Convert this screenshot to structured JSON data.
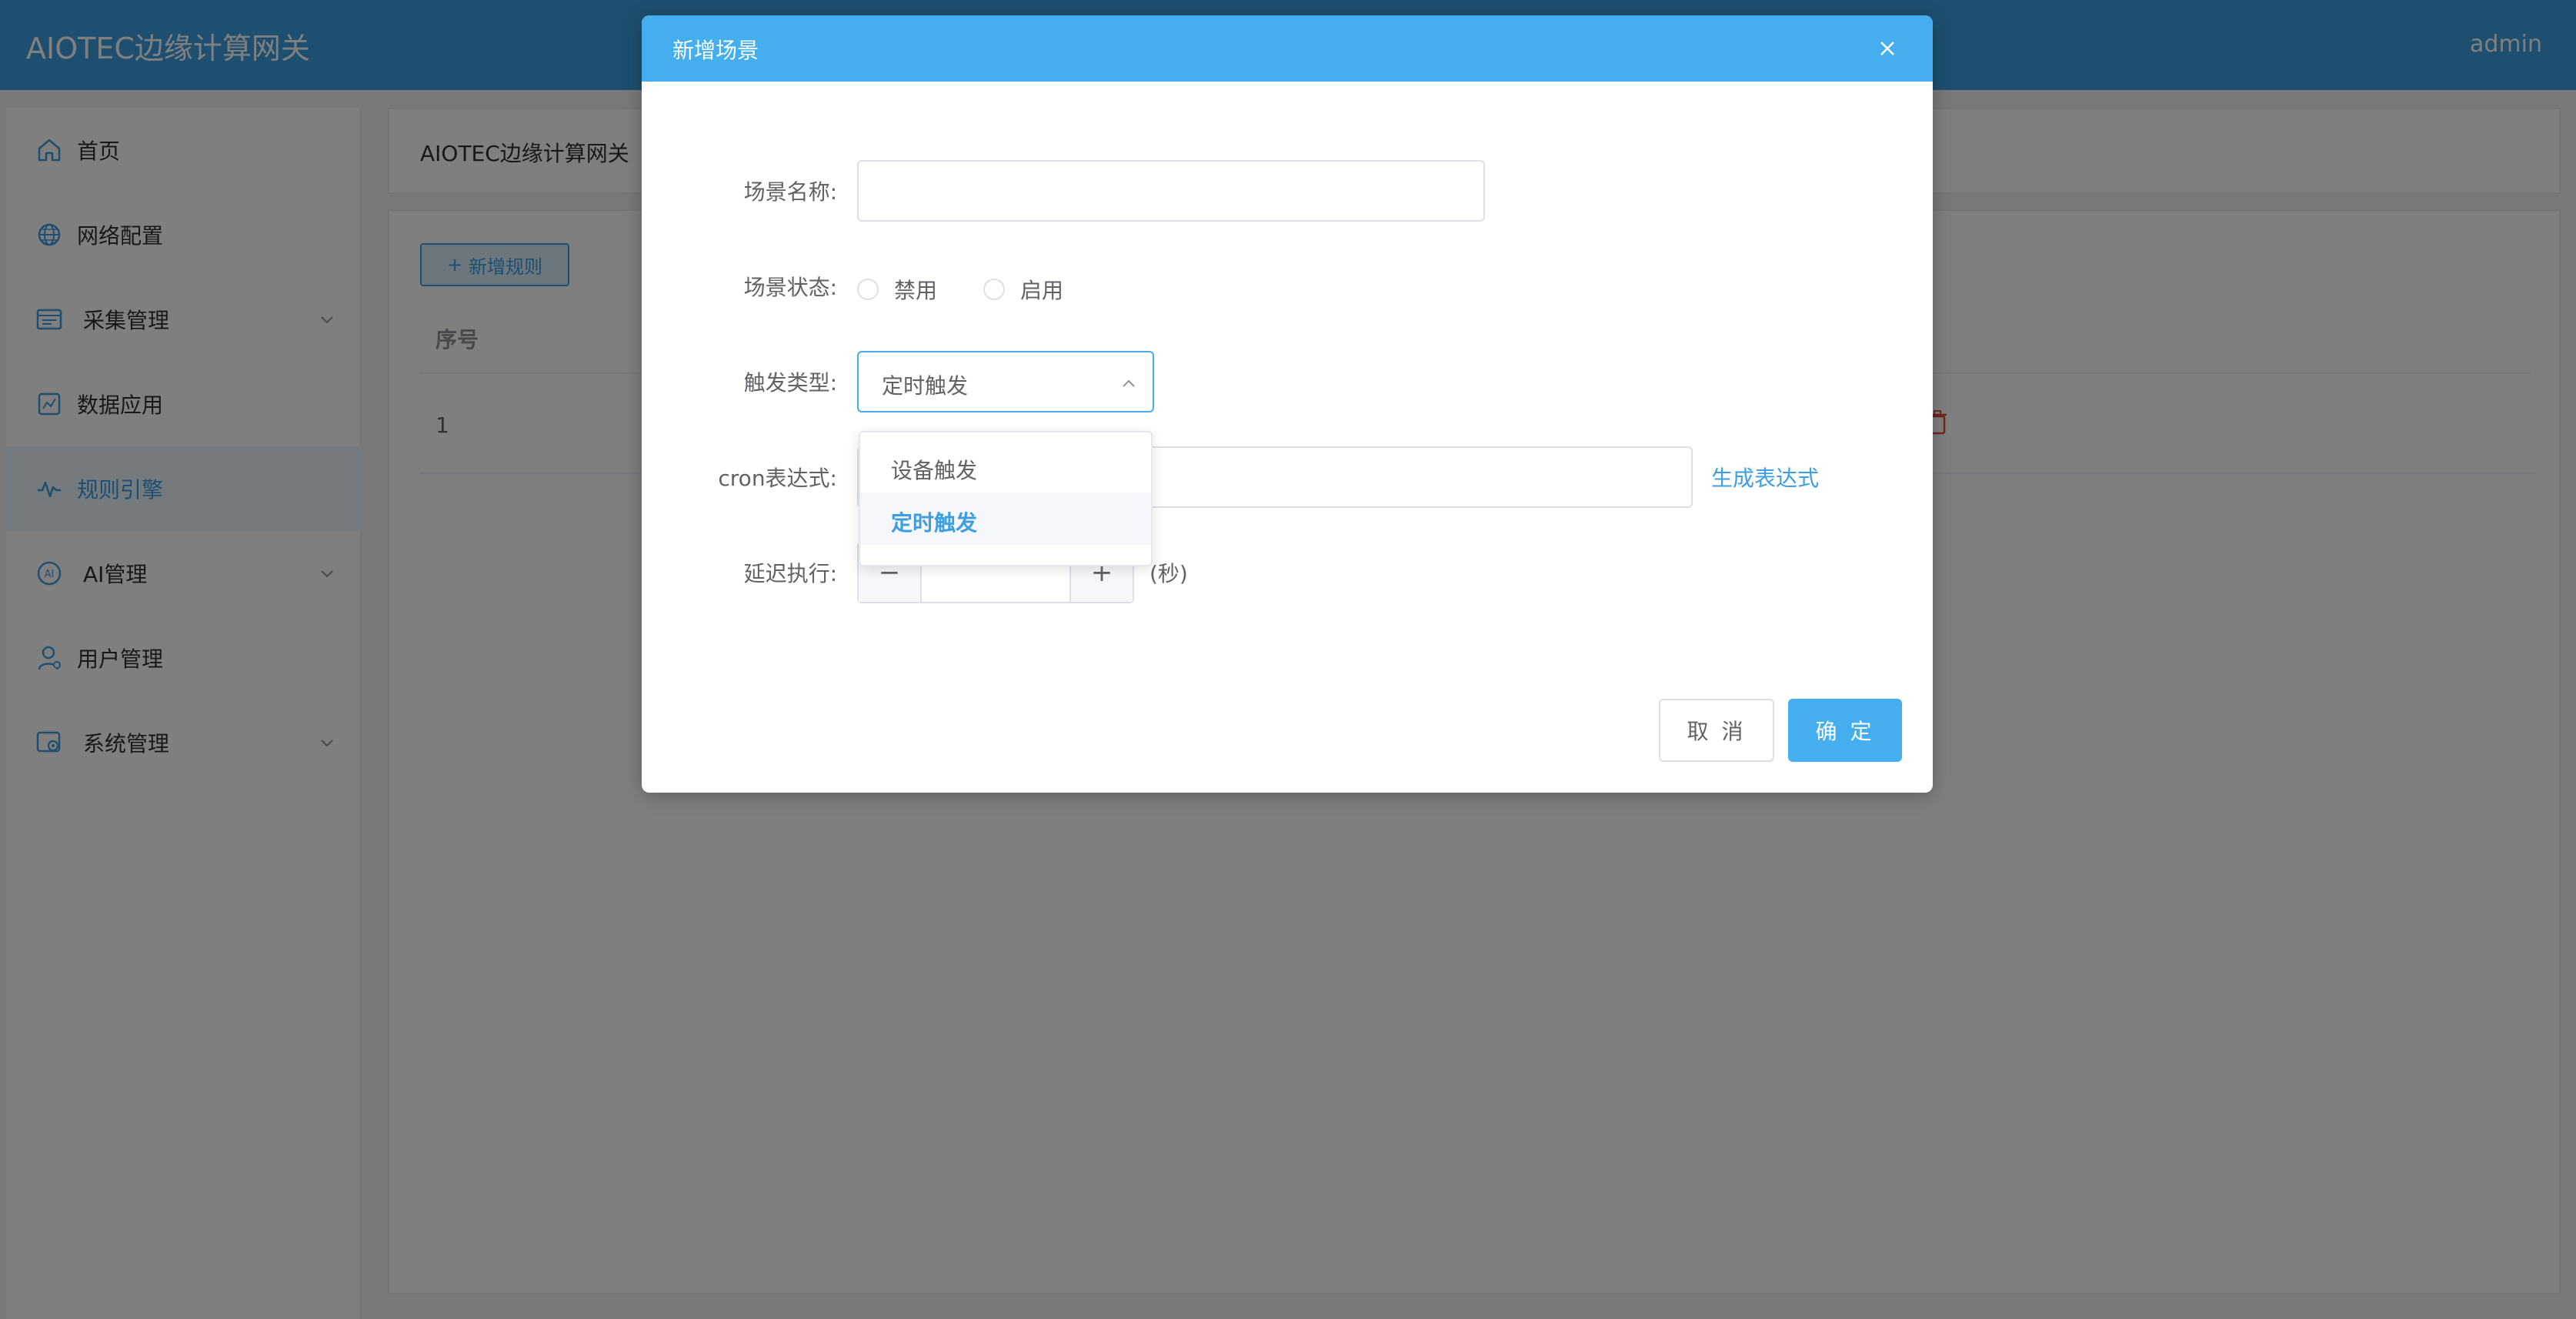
{
  "header": {
    "title": "AIOTEC边缘计算网关",
    "user": "admin"
  },
  "sidebar": {
    "items": [
      {
        "label": "首页",
        "icon": "home-icon"
      },
      {
        "label": "网络配置",
        "icon": "globe-icon"
      },
      {
        "label": "采集管理",
        "icon": "collect-icon",
        "expandable": true
      },
      {
        "label": "数据应用",
        "icon": "data-app-icon"
      },
      {
        "label": "规则引擎",
        "icon": "rule-engine-icon",
        "active": true
      },
      {
        "label": "AI管理",
        "icon": "ai-icon",
        "expandable": true
      },
      {
        "label": "用户管理",
        "icon": "user-icon"
      },
      {
        "label": "系统管理",
        "icon": "system-icon",
        "expandable": true
      }
    ]
  },
  "breadcrumb": {
    "text": "AIOTEC边缘计算网关"
  },
  "toolbar": {
    "add_rule_label": "新增规则"
  },
  "table": {
    "headers": [
      "序号"
    ],
    "rows": [
      {
        "seq": "1"
      }
    ]
  },
  "dialog": {
    "title": "新增场景",
    "fields": {
      "name": {
        "label": "场景名称:",
        "value": ""
      },
      "status": {
        "label": "场景状态:",
        "options": [
          "禁用",
          "启用"
        ],
        "selected": null
      },
      "trigger": {
        "label": "触发类型:",
        "value": "定时触发",
        "options": [
          "设备触发",
          "定时触发"
        ],
        "selected_index": 1
      },
      "cron": {
        "label": "cron表达式:",
        "value": "",
        "generate_label": "生成表达式"
      },
      "delay": {
        "label": "延迟执行:",
        "value": "",
        "unit": "(秒)",
        "minus": "−",
        "plus": "+"
      }
    },
    "buttons": {
      "cancel": "取 消",
      "confirm": "确 定"
    }
  },
  "colors": {
    "header": "#3c9ee0",
    "dialog_header": "#44aeee",
    "accent": "#3c9ee0",
    "danger": "#e2483d"
  }
}
